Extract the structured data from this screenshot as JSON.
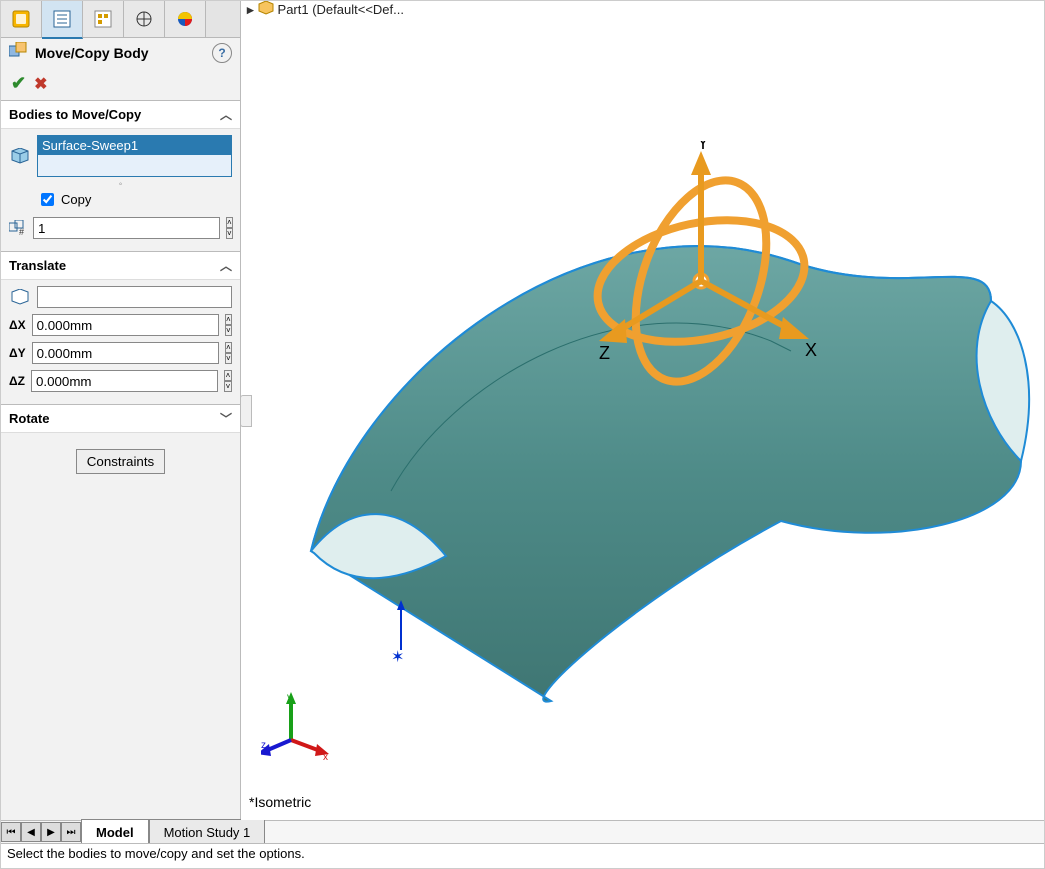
{
  "breadcrumb": {
    "part_name": "Part1  (Default<<Def..."
  },
  "panel": {
    "title": "Move/Copy Body",
    "sections": {
      "bodies": {
        "title": "Bodies to Move/Copy",
        "selected_item": "Surface-Sweep1",
        "copy_label": "Copy",
        "copy_checked": true,
        "count": "1"
      },
      "translate": {
        "title": "Translate",
        "to_value": "",
        "dx_label": "ΔX",
        "dx": "0.000mm",
        "dy_label": "ΔY",
        "dy": "0.000mm",
        "dz_label": "ΔZ",
        "dz": "0.000mm"
      },
      "rotate": {
        "title": "Rotate"
      },
      "constraints_btn": "Constraints"
    }
  },
  "viewport": {
    "view_name": "*Isometric",
    "axes": {
      "x": "X",
      "y": "Y",
      "z": "Z"
    }
  },
  "tabs": {
    "model": "Model",
    "motion": "Motion Study 1"
  },
  "status": "Select the bodies to move/copy and set the options.",
  "tri": {
    "x": "x",
    "y": "y",
    "z": "z"
  }
}
